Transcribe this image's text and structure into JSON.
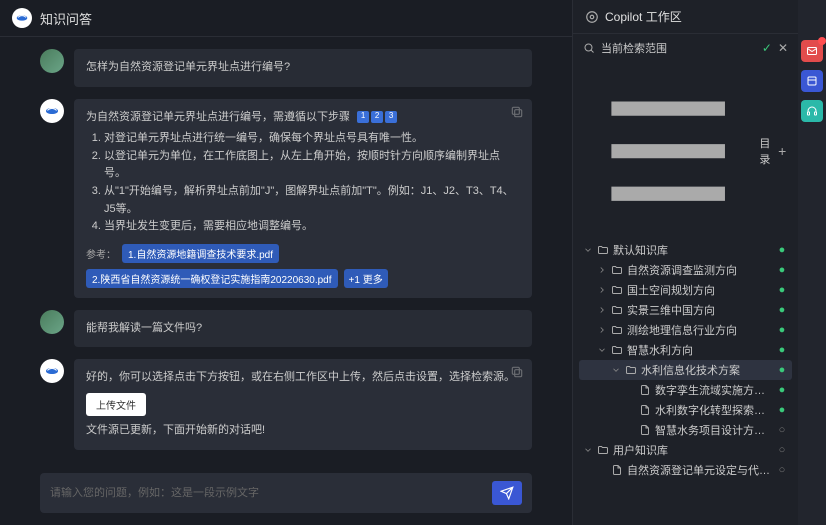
{
  "header": {
    "title": "知识问答"
  },
  "messages": {
    "q1": "怎样为自然资源登记单元界址点进行编号?",
    "a1_intro": "为自然资源登记单元界址点进行编号，需遵循以下步骤",
    "a1_steps": [
      "对登记单元界址点进行统一编号，确保每个界址点号具有唯一性。",
      "以登记单元为单位，在工作底图上，从左上角开始，按顺时针方向顺序编制界址点号。",
      "从\"1\"开始编号，解析界址点前加\"J\"，图解界址点前加\"T\"。例如：J1、J2、T3、T4、J5等。",
      "当界址发生变更后，需要相应地调整编号。"
    ],
    "a1_ref_label": "参考：",
    "a1_refs": [
      "1.自然资源地籍调查技术要求.pdf",
      "2.陕西省自然资源统一确权登记实施指南20220630.pdf"
    ],
    "a1_ref_more": "+1 更多",
    "q2": "能帮我解读一篇文件吗?",
    "a2_line1": "好的，你可以选择点击下方按钮，或在右侧工作区中上传，然后点击设置，选择检索源。",
    "a2_upload": "上传文件",
    "a2_line2": "文件源已更新，下面开始新的对话吧!"
  },
  "input": {
    "placeholder": "请输入您的问题，例如：这是一段示例文字"
  },
  "sidebar": {
    "header": "Copilot 工作区",
    "scope": "当前检索范围",
    "dir": "目录",
    "tree": [
      {
        "depth": 0,
        "icon": "folder",
        "label": "默认知识库",
        "expand": "down",
        "status": "ok"
      },
      {
        "depth": 1,
        "icon": "folder",
        "label": "自然资源调查监测方向",
        "expand": "right",
        "status": "ok"
      },
      {
        "depth": 1,
        "icon": "folder",
        "label": "国土空间规划方向",
        "expand": "right",
        "status": "ok"
      },
      {
        "depth": 1,
        "icon": "folder",
        "label": "实景三维中国方向",
        "expand": "right",
        "status": "ok"
      },
      {
        "depth": 1,
        "icon": "folder",
        "label": "测绘地理信息行业方向",
        "expand": "right",
        "status": "ok"
      },
      {
        "depth": 1,
        "icon": "folder",
        "label": "智慧水利方向",
        "expand": "down",
        "status": "ok"
      },
      {
        "depth": 2,
        "icon": "folder",
        "label": "水利信息化技术方案",
        "expand": "down",
        "status": "ok",
        "selected": true
      },
      {
        "depth": 3,
        "icon": "file",
        "label": "数字孪生流域实施方案.docx",
        "status": "ok"
      },
      {
        "depth": 3,
        "icon": "file",
        "label": "水利数字化转型探索与实践...",
        "status": "ok"
      },
      {
        "depth": 3,
        "icon": "file",
        "label": "智慧水务项目设计方案.txt",
        "status": "pend"
      },
      {
        "depth": 0,
        "icon": "folder",
        "label": "用户知识库",
        "expand": "down",
        "status": "pend"
      },
      {
        "depth": 1,
        "icon": "file",
        "label": "自然资源登记单元设定与代码编制...",
        "status": "pend"
      }
    ]
  }
}
